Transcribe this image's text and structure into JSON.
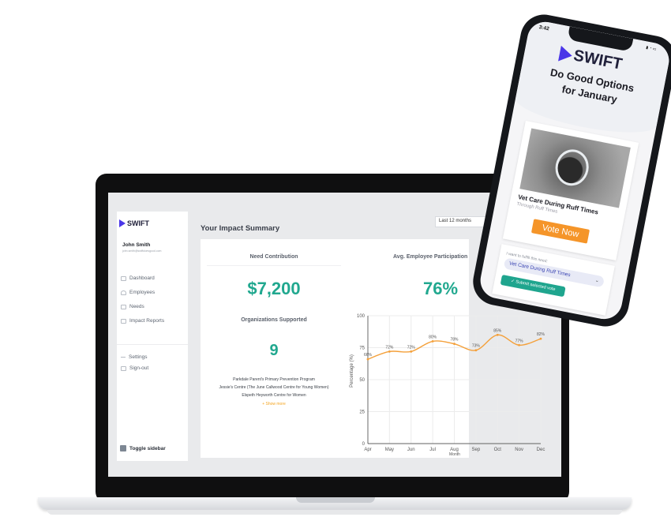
{
  "sidebar": {
    "logo_text": "SWIFT",
    "user_name": "John Smith",
    "user_email": "john.smith@swiftdoesgood.com",
    "items": [
      {
        "label": "Dashboard",
        "icon": "grid-icon"
      },
      {
        "label": "Employees",
        "icon": "user-icon"
      },
      {
        "label": "Needs",
        "icon": "list-icon"
      },
      {
        "label": "Impact Reports",
        "icon": "report-icon"
      }
    ],
    "lower_items": [
      {
        "label": "Settings",
        "icon": "gear-icon"
      },
      {
        "label": "Sign-out",
        "icon": "sign-out-icon"
      }
    ],
    "toggle_label": "Toggle sidebar"
  },
  "main": {
    "title": "Your Impact Summary",
    "period_select": "Last 12 months",
    "need_contribution_label": "Need Contribution",
    "need_contribution_value": "$7,200",
    "orgs_label": "Organizations Supported",
    "orgs_value": "9",
    "orgs": [
      "Parkdale Parent's Primary Prevention Program",
      "Jessie's Centre (The June Callwood Centre for Young Women)",
      "Elspeth Heyworth Centre for Women"
    ],
    "show_more": "+ Show more",
    "participation_label": "Avg. Employee Participation",
    "participation_value": "76%"
  },
  "chart_data": {
    "type": "line",
    "categories": [
      "Apr",
      "May",
      "Jun",
      "Jul",
      "Aug",
      "Sep",
      "Oct",
      "Nov",
      "Dec"
    ],
    "values": [
      66,
      72,
      72,
      80,
      78,
      73,
      85,
      77,
      82
    ],
    "value_labels": [
      "66%",
      "72%",
      "72%",
      "80%",
      "78%",
      "73%",
      "85%",
      "77%",
      "82%"
    ],
    "xlabel": "Month",
    "ylabel": "Percentage (%)",
    "ylim": [
      0,
      100
    ],
    "yticks": [
      "0",
      "25",
      "50",
      "75",
      "100"
    ],
    "grid": true,
    "color": "#f4a03a"
  },
  "phone": {
    "time": "3:42",
    "logo_text": "SWIFT",
    "heading_line1": "Do Good Options",
    "heading_line2": "for January",
    "card_title": "Vet Care During Ruff Times",
    "card_subtitle": "Through Ruff Times",
    "vote_label": "Vote Now",
    "fulfil_label": "I want to fulfill this need:",
    "selected_need": "Vet Care During Ruff Times",
    "submit_label": "Submit selected vote"
  },
  "colors": {
    "brand": "#4a36e8",
    "accent_teal": "#21a88f",
    "accent_orange": "#f59529"
  }
}
